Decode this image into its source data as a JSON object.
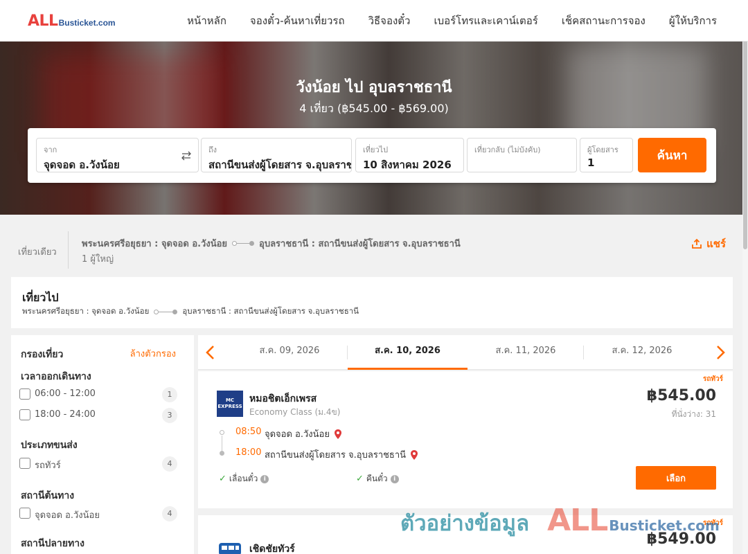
{
  "logo": {
    "all": "ALL",
    "rest": "Busticket.com"
  },
  "nav": [
    {
      "label": "หน้าหลัก"
    },
    {
      "label": "จองตั๋ว-ค้นหาเที่ยวรถ"
    },
    {
      "label": "วิธีจองตั๋ว"
    },
    {
      "label": "เบอร์โทรและเคาน์เตอร์"
    },
    {
      "label": "เช็คสถานะการจอง"
    },
    {
      "label": "ผู้ให้บริการ"
    }
  ],
  "hero": {
    "title": "วังน้อย ไป อุบลราชธานี",
    "subtitle": "4 เที่ยว (฿545.00 - ฿569.00)"
  },
  "search": {
    "from_label": "จาก",
    "from_value": "จุดจอด อ.วังน้อย",
    "to_label": "ถึง",
    "to_value": "สถานีขนส่งผู้โดยสาร จ.อุบลราชธานี",
    "depart_label": "เที่ยวไป",
    "depart_value": "10 สิงหาคม 2026",
    "return_label": "เที่ยวกลับ (ไม่บังคับ)",
    "return_value": "",
    "pax_label": "ผู้โดยสาร",
    "pax_value": "1",
    "button": "ค้นหา"
  },
  "summary": {
    "trip_type": "เที่ยวเดียว",
    "origin": "พระนครศรีอยุธยา : จุดจอด อ.วังน้อย",
    "destination": "อุบลราชธานี : สถานีขนส่งผู้โดยสาร จ.อุบลราชธานี",
    "passengers": "1 ผู้ใหญ่",
    "share": "แชร์"
  },
  "outbound": {
    "title": "เที่ยวไป",
    "origin": "พระนครศรีอยุธยา : จุดจอด อ.วังน้อย",
    "destination": "อุบลราชธานี : สถานีขนส่งผู้โดยสาร จ.อุบลราชธานี"
  },
  "filters": {
    "title": "กรองเที่ยว",
    "clear": "ล้างตัวกรอง",
    "groups": [
      {
        "title": "เวลาออกเดินทาง",
        "options": [
          {
            "label": "06:00 - 12:00",
            "count": "1"
          },
          {
            "label": "18:00 - 24:00",
            "count": "3"
          }
        ]
      },
      {
        "title": "ประเภทขนส่ง",
        "options": [
          {
            "label": "รถทัวร์",
            "count": "4"
          }
        ]
      },
      {
        "title": "สถานีต้นทาง",
        "options": [
          {
            "label": "จุดจอด อ.วังน้อย",
            "count": "4"
          }
        ]
      },
      {
        "title": "สถานีปลายทาง",
        "options": []
      }
    ]
  },
  "dates": [
    {
      "label": "ส.ค. 09, 2026"
    },
    {
      "label": "ส.ค. 10, 2026"
    },
    {
      "label": "ส.ค. 11, 2026"
    },
    {
      "label": "ส.ค. 12, 2026"
    }
  ],
  "trips": [
    {
      "tag": "รถทัวร์",
      "logo_text": "MC EXPRESS",
      "operator": "หมอชิตเอ็กเพรส",
      "class": "Economy Class (ม.4ข)",
      "price": "฿545.00",
      "seats": "ที่นั่งว่าง: 31",
      "depart_time": "08:50",
      "depart_stop": "จุดจอด อ.วังน้อย",
      "arrive_time": "18:00",
      "arrive_stop": "สถานีขนส่งผู้โดยสาร จ.อุบลราชธานี",
      "feature1": "เลื่อนตั๋ว",
      "feature2": "คืนตั๋ว",
      "button": "เลือก"
    },
    {
      "tag": "รถทัวร์",
      "operator": "เชิดชัยทัวร์",
      "price": "฿549.00"
    }
  ],
  "watermark": {
    "text": "ตัวอย่างข้อมูล",
    "all": "ALL",
    "rest": "Busticket.com"
  },
  "colors": {
    "accent": "#ff6a00",
    "brand_blue": "#2a5596",
    "brand_red": "#e8413d"
  }
}
